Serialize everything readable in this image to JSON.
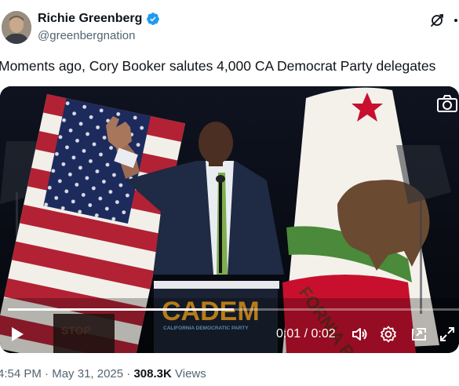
{
  "author": {
    "display_name": "Richie Greenberg",
    "handle": "@greenbergnation",
    "verified": true
  },
  "tweet": {
    "text": "Moments ago, Cory Booker salutes 4,000 CA Democrat Party delegates"
  },
  "media": {
    "podium_logo": "CADEM",
    "podium_subtitle": "CALIFORNIA DEMOCRATIC PARTY",
    "sign_text": "STOP",
    "banner_text": "FORNIA REPUB",
    "time_display": "0:01 / 0:02",
    "progress": 0.5,
    "icons": [
      "play-icon",
      "volume-icon",
      "settings-icon",
      "pip-icon",
      "fullscreen-icon",
      "camera-icon"
    ]
  },
  "meta": {
    "time": "4:54 PM",
    "sep1": " · ",
    "date": "May 31, 2025",
    "sep2": " · ",
    "views_count": "308.3K",
    "views_label": " Views"
  },
  "colors": {
    "verified_blue": "#1d9bf0",
    "text_primary": "#0f1419",
    "text_secondary": "#536471"
  }
}
